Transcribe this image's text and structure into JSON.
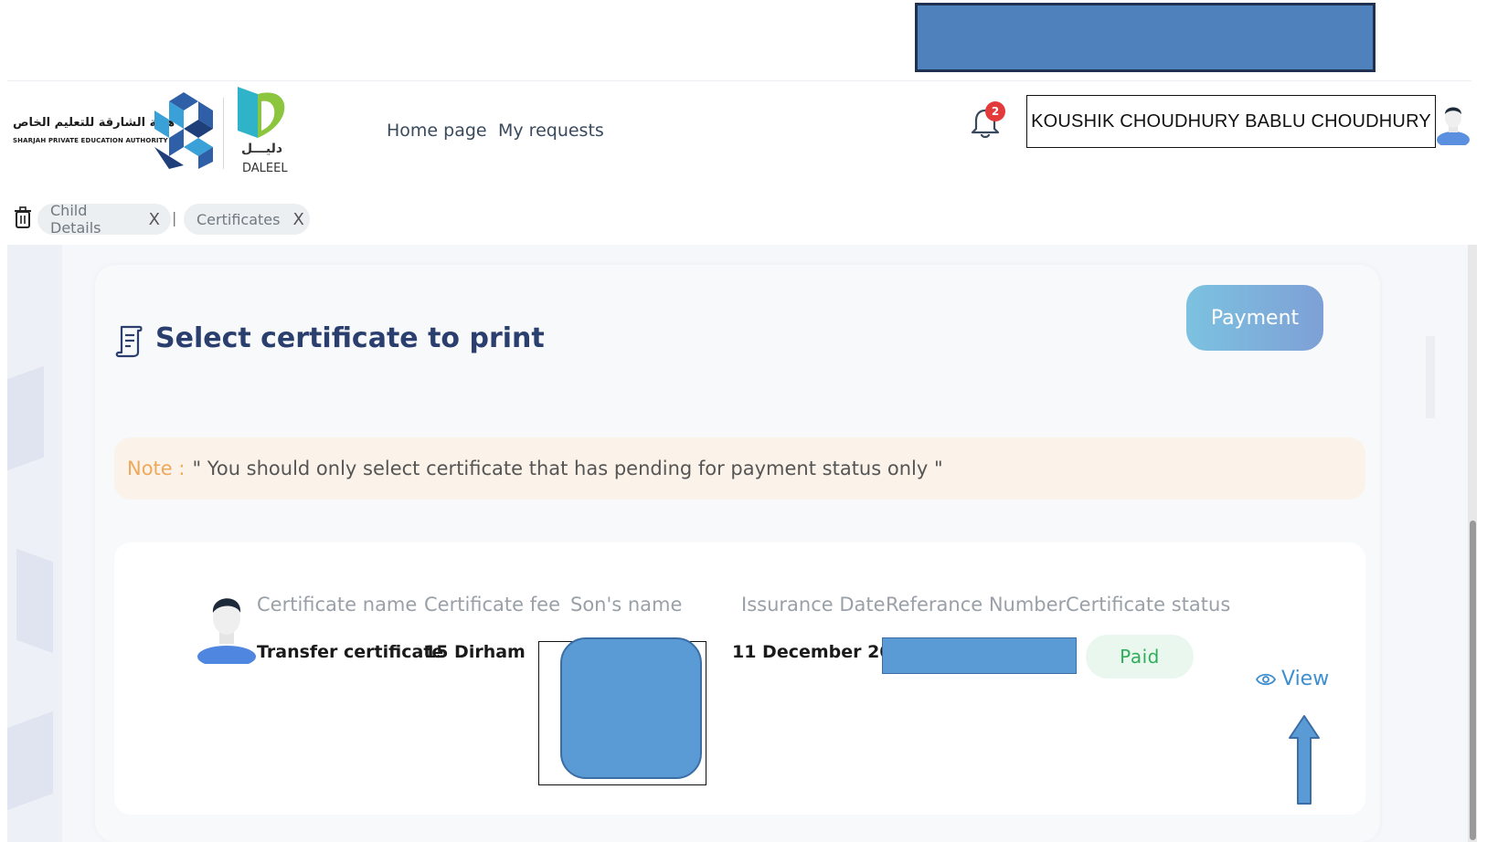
{
  "header": {
    "org_name_ar": "هيئة الشارقة للتعليم الخاص",
    "org_name_en": "SHARJAH PRIVATE EDUCATION AUTHORITY",
    "app_name_ar": "دليـــل",
    "app_name_en": "DALEEL",
    "nav": {
      "home": "Home page",
      "requests": "My requests"
    },
    "notification_count": "2",
    "user_name": "KOUSHIK CHOUDHURY BABLU CHOUDHURY"
  },
  "tabs": {
    "items": [
      {
        "label": "Child Details"
      },
      {
        "label": "Certificates"
      }
    ],
    "separator": "|",
    "close_glyph": "X"
  },
  "main": {
    "title": "Select certificate to print",
    "payment_button": "Payment",
    "note": {
      "label": "Note :",
      "text": "\" You should only select certificate that has pending for payment status only \""
    },
    "table": {
      "headers": {
        "name": "Certificate name",
        "fee": "Certificate fee",
        "son": "Son's name",
        "date": "Issurance Date",
        "ref": "Referance Number",
        "status": "Certificate status"
      },
      "row": {
        "name": "Transfer certificate",
        "fee": "15 Dirham",
        "date": "11 December 2023",
        "status": "Paid",
        "action": "View"
      }
    }
  },
  "colors": {
    "title": "#2b3f6e",
    "paid_text": "#2fae5a",
    "view_link": "#3e8fd0",
    "note_label": "#f0a85a",
    "redaction": "#5b9bd5"
  }
}
